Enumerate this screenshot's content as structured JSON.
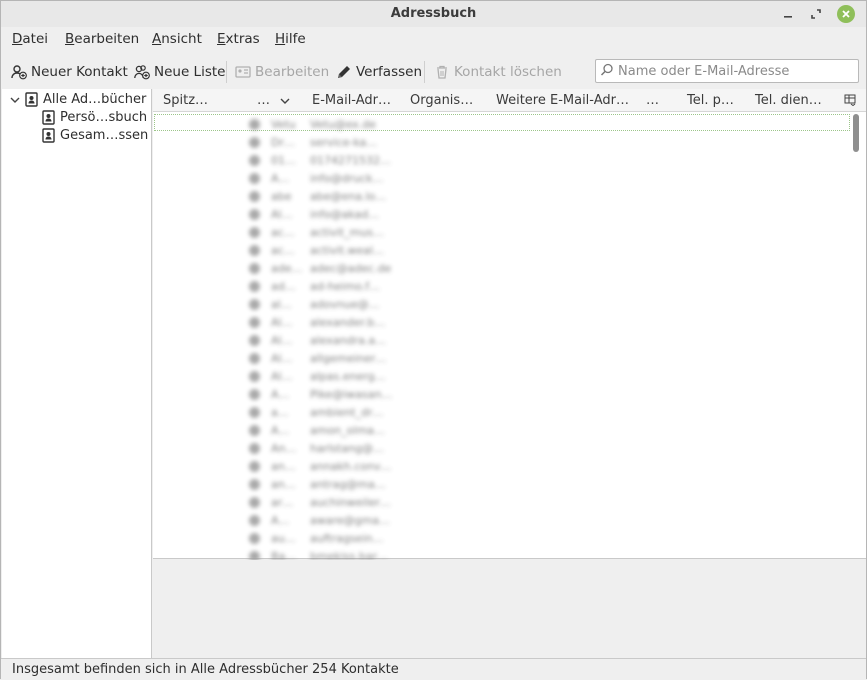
{
  "window": {
    "title": "Adressbuch"
  },
  "menu": [
    {
      "label": "Datei",
      "mnemonic": "D"
    },
    {
      "label": "Bearbeiten",
      "mnemonic": "B"
    },
    {
      "label": "Ansicht",
      "mnemonic": "A"
    },
    {
      "label": "Extras",
      "mnemonic": "E"
    },
    {
      "label": "Hilfe",
      "mnemonic": "H"
    }
  ],
  "toolbar": {
    "new_contact": "Neuer Kontakt",
    "new_list": "Neue Liste",
    "edit": "Bearbeiten",
    "compose": "Verfassen",
    "delete": "Kontakt löschen"
  },
  "search": {
    "placeholder": "Name oder E-Mail-Adresse"
  },
  "tree": {
    "root": "Alle Ad…bücher",
    "children": [
      "Persö…sbuch",
      "Gesam…ssen"
    ]
  },
  "columns": {
    "nickname": "Spitz…",
    "name": "…",
    "email": "E-Mail-Adr…",
    "org": "Organis…",
    "other_email": "Weitere E-Mail-Adr…",
    "extra": "…",
    "tel_private": "Tel. p…",
    "tel_work": "Tel. dien…"
  },
  "contacts": [
    {
      "name": "Vetu",
      "email": "Vetu@ex.de"
    },
    {
      "name": "Dr…",
      "email": "service-ka…"
    },
    {
      "name": "01…",
      "email": "0174271532…"
    },
    {
      "name": "A…",
      "email": "info@druck…"
    },
    {
      "name": "abe",
      "email": "abe@ena.lo…"
    },
    {
      "name": "Al…",
      "email": "info@akad…"
    },
    {
      "name": "ac…",
      "email": "activit_mus…"
    },
    {
      "name": "ac…",
      "email": "activit.weal…"
    },
    {
      "name": "ade…",
      "email": "adec@adec.de"
    },
    {
      "name": "ad…",
      "email": "ad-heimo.f…"
    },
    {
      "name": "al…",
      "email": "adovnue@…"
    },
    {
      "name": "Al…",
      "email": "alexander.b…"
    },
    {
      "name": "Al…",
      "email": "alexandra.a…"
    },
    {
      "name": "Al…",
      "email": "allgemeiner…"
    },
    {
      "name": "Al…",
      "email": "alpas.energ…"
    },
    {
      "name": "A…",
      "email": "Pike@iwasan…"
    },
    {
      "name": "a…",
      "email": "ambient_dr…"
    },
    {
      "name": "A…",
      "email": "amon_olma…"
    },
    {
      "name": "An…",
      "email": "harlstang@…"
    },
    {
      "name": "an…",
      "email": "annakh.conv…"
    },
    {
      "name": "an…",
      "email": "antrag@ma…"
    },
    {
      "name": "ar…",
      "email": "auchinweiler…"
    },
    {
      "name": "A…",
      "email": "aware@gma…"
    },
    {
      "name": "au…",
      "email": "auftragsein…"
    },
    {
      "name": "Ba…",
      "email": "bmekiss.bar…"
    }
  ],
  "status": {
    "text": "Insgesamt befinden sich in Alle Adressbücher 254 Kontakte"
  }
}
